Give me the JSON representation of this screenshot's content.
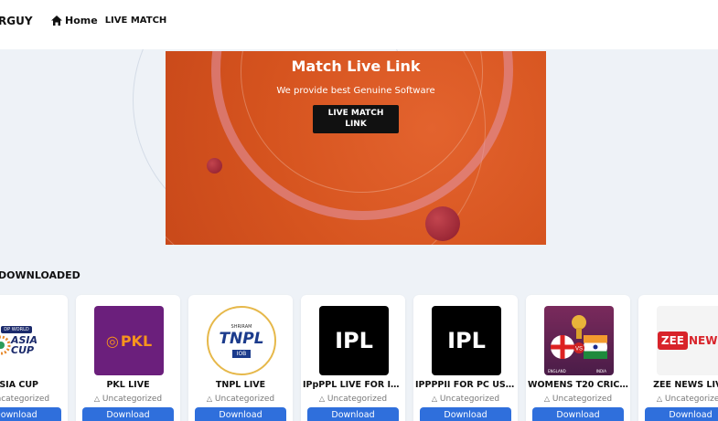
{
  "header": {
    "brand": "RGUY",
    "home_label": "Home",
    "live_match_label": "LIVE MATCH"
  },
  "hero": {
    "title": "Match Live Link",
    "subtitle": "We provide best Genuine Software",
    "button_line1": "LIVE MATCH",
    "button_line2": "LINK"
  },
  "section": {
    "title": "DOWNLOADED"
  },
  "cards": [
    {
      "title": "ASIA CUP",
      "category": "Uncategorized",
      "button": "Download",
      "logo": "asia-cup-logo",
      "logo_text": "ASIA CUP",
      "logo_small": "DP WORLD"
    },
    {
      "title": "PKL LIVE",
      "category": "Uncategorized",
      "button": "Download",
      "logo": "pkl-logo",
      "logo_text": "PKL"
    },
    {
      "title": "TNPL LIVE",
      "category": "Uncategorized",
      "button": "Download",
      "logo": "tnpl-logo",
      "logo_text": "TNPL",
      "logo_small": "SHRIRAM",
      "logo_sponsor": "IOB"
    },
    {
      "title": "IPpPPL LIVE FOR IOS...",
      "category": "Uncategorized",
      "button": "Download",
      "logo": "ipl-logo",
      "logo_text": "IPL"
    },
    {
      "title": "IPPPPII FOR PC USERS",
      "category": "Uncategorized",
      "button": "Download",
      "logo": "ipl-logo",
      "logo_text": "IPL"
    },
    {
      "title": "WOMENS T20 CRIC...",
      "category": "Uncategorized",
      "button": "Download",
      "logo": "womens-t20-logo",
      "logo_left": "ENGLAND",
      "logo_right": "INDIA"
    },
    {
      "title": "ZEE NEWS LIVE",
      "category": "Uncategorized",
      "button": "Download",
      "logo": "zee-news-logo",
      "logo_text": "ZEE",
      "logo_text2": "NEWS"
    }
  ],
  "colors": {
    "hero_bg": "#d6541f",
    "button_blue": "#2f6fdc",
    "page_bg": "#eef2f7"
  }
}
